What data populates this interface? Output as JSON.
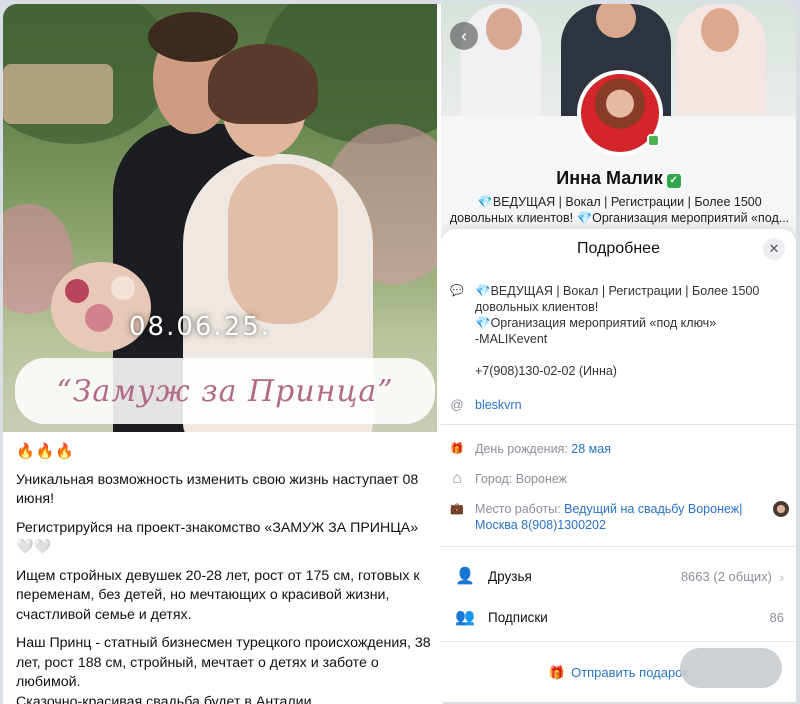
{
  "post": {
    "date_overlay": "08.06.25.",
    "banner_title": "“Замуж за Принца”",
    "fire_emojis": "🔥🔥🔥",
    "paragraph1": "Уникальная возможность изменить свою жизнь наступает 08 июня!",
    "paragraph2": "Регистрируйся на проект-знакомство «ЗАМУЖ ЗА ПРИНЦА» 🤍🤍",
    "paragraph3": "Ищем стройных девушек 20-28 лет, рост от 175 см, готовых к переменам, без детей, но мечтающих о красивой жизни, счастливой семье и детях.",
    "paragraph4": "Наш Принц - статный бизнесмен турецкого происхождения, 38 лет, рост 188 см, стройный, мечтает о детях и заботе о любимой.",
    "paragraph5": "Сказочно-красивая свадьба будет в Анталии."
  },
  "profile": {
    "name": "Инна Малик",
    "verified_icon": "✓",
    "bio_short": "💎ВЕДУЩАЯ | Вокал | Регистрации | Более 1500 довольных клиентов! 💎Организация мероприятий «под..."
  },
  "sheet": {
    "title": "Подробнее",
    "close_icon": "✕",
    "bio_lines": [
      "💎ВЕДУЩАЯ | Вокал | Регистрации | Более 1500",
      "довольных клиентов!",
      "💎Организация мероприятий «под ключ»",
      "-MALIKevent",
      "",
      "+7(908)130-02-02 (Инна)"
    ],
    "link": "bleskvrn",
    "birthday_label": "День рождения:",
    "birthday_value": "28 мая",
    "city": "Город: Воронеж",
    "work_label": "Место работы:",
    "work_value_line1": "Ведущий на свадьбу Воронеж|",
    "work_value_line2": "Москва 8(908)1300202",
    "friends_label": "Друзья",
    "friends_count": "8663 (2 общих)",
    "subs_label": "Подписки",
    "subs_count": "86",
    "gift_label": "Отправить подарок"
  },
  "icons": {
    "bio": "💬",
    "link": "@",
    "birthday": "🎁",
    "city": "⌂",
    "work": "💼",
    "friends": "👤",
    "subs": "👥",
    "gift": "🎁",
    "back": "‹",
    "chevron": "›"
  },
  "colors": {
    "accent_blue": "#2a73c4",
    "banner_pink": "#b36a88",
    "verified_green": "#2fa84f"
  }
}
